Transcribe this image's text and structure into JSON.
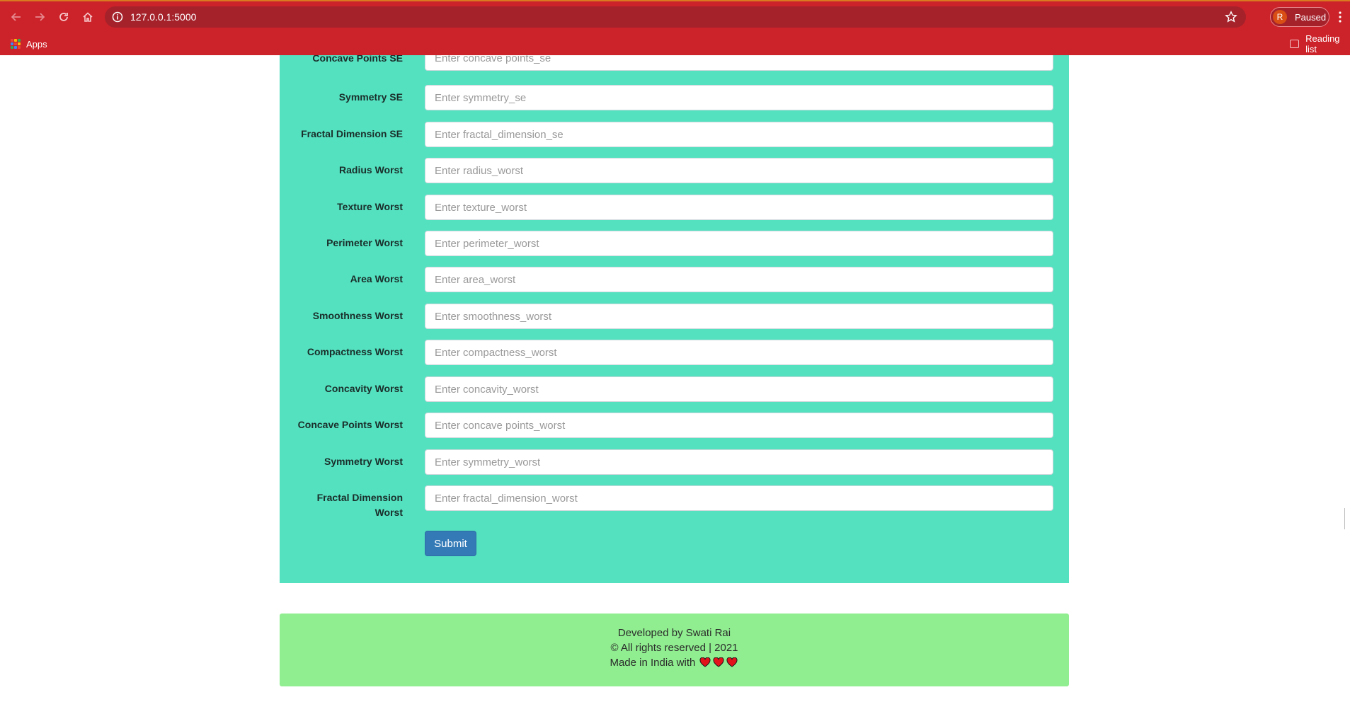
{
  "browser": {
    "url": "127.0.0.1:5000",
    "profile_initial": "R",
    "profile_status": "Paused",
    "bookmarks": {
      "apps_label": "Apps",
      "reading_list_label": "Reading list"
    },
    "theme_color": "#cc2229"
  },
  "form": {
    "background": "#54e1c0",
    "fields": [
      {
        "label": "Concave Points SE",
        "placeholder": "Enter concave points_se"
      },
      {
        "label": "Symmetry SE",
        "placeholder": "Enter symmetry_se"
      },
      {
        "label": "Fractal Dimension SE",
        "placeholder": "Enter fractal_dimension_se"
      },
      {
        "label": "Radius Worst",
        "placeholder": "Enter radius_worst"
      },
      {
        "label": "Texture Worst",
        "placeholder": "Enter texture_worst"
      },
      {
        "label": "Perimeter Worst",
        "placeholder": "Enter perimeter_worst"
      },
      {
        "label": "Area Worst",
        "placeholder": "Enter area_worst"
      },
      {
        "label": "Smoothness Worst",
        "placeholder": "Enter smoothness_worst"
      },
      {
        "label": "Compactness Worst",
        "placeholder": "Enter compactness_worst"
      },
      {
        "label": "Concavity Worst",
        "placeholder": "Enter concavity_worst"
      },
      {
        "label": "Concave Points Worst",
        "placeholder": "Enter concave points_worst"
      },
      {
        "label": "Symmetry Worst",
        "placeholder": "Enter symmetry_worst"
      },
      {
        "label": "Fractal Dimension Worst",
        "placeholder": "Enter fractal_dimension_worst"
      }
    ],
    "submit_label": "Submit",
    "submit_color": "#337ab7"
  },
  "footer": {
    "background": "#90ee90",
    "developed_by": "Developed by Swati Rai",
    "rights": "© All rights reserved | 2021",
    "made_in": "Made in India with",
    "hearts": 3
  }
}
